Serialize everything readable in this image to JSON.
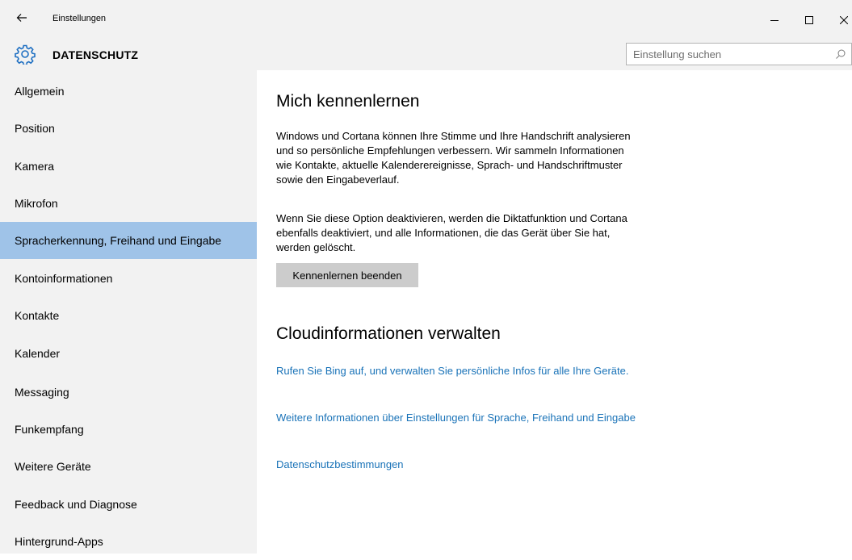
{
  "window": {
    "title": "Einstellungen",
    "controls": {
      "minimize": "—",
      "maximize": "☐",
      "close": "✕"
    }
  },
  "header": {
    "title": "DATENSCHUTZ",
    "search_placeholder": "Einstellung suchen"
  },
  "sidebar": {
    "selected_index": 4,
    "selected_color": "#9fc3e8",
    "items": [
      {
        "label": "Allgemein"
      },
      {
        "label": "Position"
      },
      {
        "label": "Kamera"
      },
      {
        "label": "Mikrofon"
      },
      {
        "label": "Spracherkennung, Freihand und Eingabe"
      },
      {
        "label": "Kontoinformationen"
      },
      {
        "label": "Kontakte"
      },
      {
        "label": "Kalender"
      },
      {
        "label": "Messaging"
      },
      {
        "label": "Funkempfang"
      },
      {
        "label": "Weitere Geräte"
      },
      {
        "label": "Feedback und Diagnose"
      },
      {
        "label": "Hintergrund-Apps"
      }
    ]
  },
  "main": {
    "section1": {
      "heading": "Mich kennenlernen",
      "paragraph1": "Windows und Cortana können Ihre Stimme und Ihre Handschrift analysieren und so persönliche Empfehlungen verbessern. Wir sammeln Informationen wie Kontakte, aktuelle Kalenderereignisse, Sprach- und Handschriftmuster sowie den Eingabeverlauf.",
      "paragraph2": "Wenn Sie diese Option deaktivieren, werden die Diktatfunktion und Cortana ebenfalls deaktiviert, und alle Informationen, die das Gerät über Sie hat, werden gelöscht.",
      "button_label": "Kennenlernen beenden"
    },
    "section2": {
      "heading": "Cloudinformationen verwalten",
      "links": [
        "Rufen Sie Bing auf, und verwalten Sie persönliche Infos für alle Ihre Geräte.",
        "Weitere Informationen über Einstellungen für Sprache, Freihand und Eingabe",
        "Datenschutzbestimmungen"
      ]
    },
    "link_color": "#1a73b8"
  },
  "icons": {
    "back": "back-arrow-icon",
    "settings": "gear-icon",
    "search": "search-icon"
  }
}
